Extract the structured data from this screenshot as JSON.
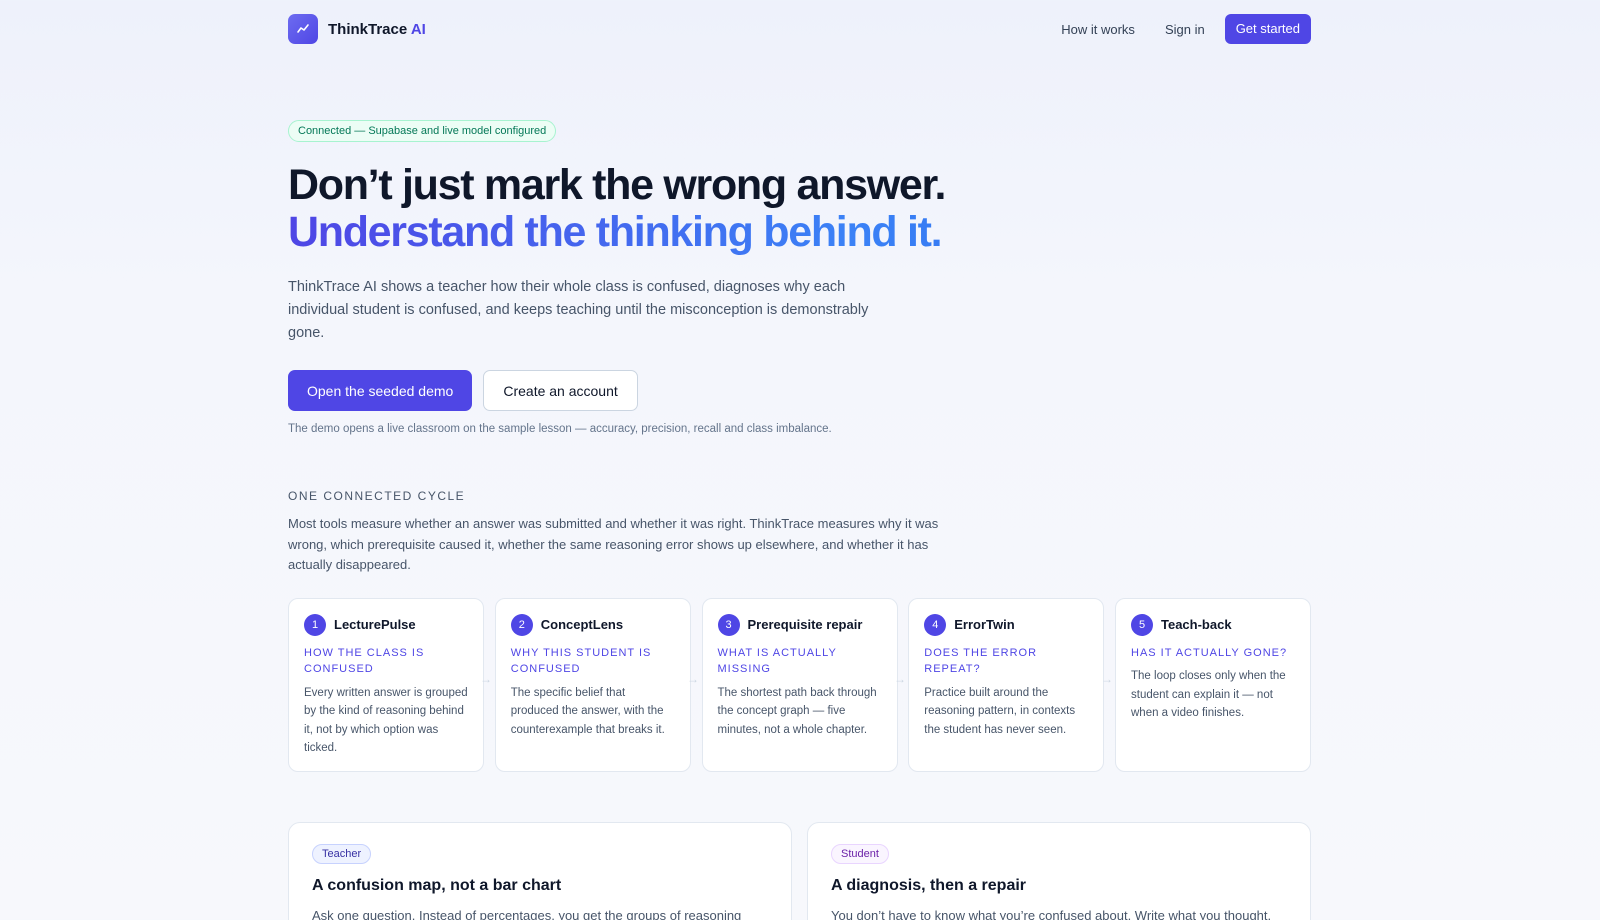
{
  "brand": {
    "name": "ThinkTrace",
    "suffix": "AI"
  },
  "nav": {
    "how_it_works": "How it works",
    "sign_in": "Sign in",
    "get_started": "Get started"
  },
  "hero": {
    "status": "Connected — Supabase and live model configured",
    "headline_1": "Don’t just mark the wrong answer.",
    "headline_2": "Understand the thinking behind it.",
    "lead": "ThinkTrace AI shows a teacher how their whole class is confused, diagnoses why each individual student is confused, and keeps teaching until the misconception is demonstrably gone.",
    "primary_cta": "Open the seeded demo",
    "secondary_cta": "Create an account",
    "note": "The demo opens a live classroom on the sample lesson — accuracy, precision, recall and class imbalance."
  },
  "cycle": {
    "eyebrow": "ONE CONNECTED CYCLE",
    "description": "Most tools measure whether an answer was submitted and whether it was right. ThinkTrace measures why it was wrong, which prerequisite caused it, whether the same reasoning error shows up elsewhere, and whether it has actually disappeared.",
    "steps": [
      {
        "num": "1",
        "title": "LecturePulse",
        "question": "HOW THE CLASS IS CONFUSED",
        "body": "Every written answer is grouped by the kind of reasoning behind it, not by which option was ticked."
      },
      {
        "num": "2",
        "title": "ConceptLens",
        "question": "WHY THIS STUDENT IS CONFUSED",
        "body": "The specific belief that produced the answer, with the counterexample that breaks it."
      },
      {
        "num": "3",
        "title": "Prerequisite repair",
        "question": "WHAT IS ACTUALLY MISSING",
        "body": "The shortest path back through the concept graph — five minutes, not a whole chapter."
      },
      {
        "num": "4",
        "title": "ErrorTwin",
        "question": "DOES THE ERROR REPEAT?",
        "body": "Practice built around the reasoning pattern, in contexts the student has never seen."
      },
      {
        "num": "5",
        "title": "Teach-back",
        "question": "HAS IT ACTUALLY GONE?",
        "body": "The loop closes only when the student can explain it — not when a video finishes."
      }
    ]
  },
  "cards": {
    "teacher": {
      "tag": "Teacher",
      "title": "A confusion map, not a bar chart",
      "body": "Ask one question. Instead of percentages, you get the groups of reasoning"
    },
    "student": {
      "tag": "Student",
      "title": "A diagnosis, then a repair",
      "body": "You don’t have to know what you’re confused about. Write what you thought,"
    }
  },
  "colors": {
    "accent": "#4f46e5",
    "success": "#047857",
    "student_tag": "#6b21a8"
  }
}
